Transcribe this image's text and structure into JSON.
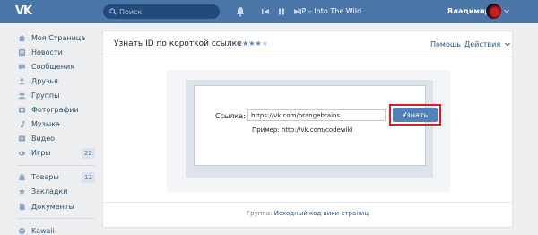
{
  "header": {
    "logo": "VK",
    "search_placeholder": "Поиск",
    "track": "LP – Into The Wild",
    "username": "Владимир"
  },
  "sidebar": {
    "items": [
      {
        "label": "Моя Страница",
        "icon": "home-icon"
      },
      {
        "label": "Новости",
        "icon": "news-icon"
      },
      {
        "label": "Сообщения",
        "icon": "messages-icon"
      },
      {
        "label": "Друзья",
        "icon": "friends-icon"
      },
      {
        "label": "Группы",
        "icon": "groups-icon"
      },
      {
        "label": "Фотографии",
        "icon": "photos-icon"
      },
      {
        "label": "Музыка",
        "icon": "music-icon"
      },
      {
        "label": "Видео",
        "icon": "video-icon"
      },
      {
        "label": "Игры",
        "icon": "games-icon",
        "badge": "22"
      }
    ],
    "items2": [
      {
        "label": "Товары",
        "icon": "goods-icon",
        "badge": "12"
      },
      {
        "label": "Закладки",
        "icon": "bookmarks-icon"
      },
      {
        "label": "Документы",
        "icon": "documents-icon"
      }
    ],
    "items3": [
      {
        "label": "Kawaii",
        "icon": "app-icon"
      }
    ]
  },
  "card": {
    "title": "Узнать ID по короткой ссылке",
    "rating_stars": 4,
    "help": "Помощь",
    "actions": "Действия"
  },
  "demo": {
    "link_label": "Ссылка:",
    "link_value": "https://vk.com/orangebrains",
    "button": "Узнать",
    "example_label": "Пример: http://vk.com/codewiki"
  },
  "footer": {
    "prefix": "Группа:",
    "link": "Исходный код вики-страниц"
  }
}
